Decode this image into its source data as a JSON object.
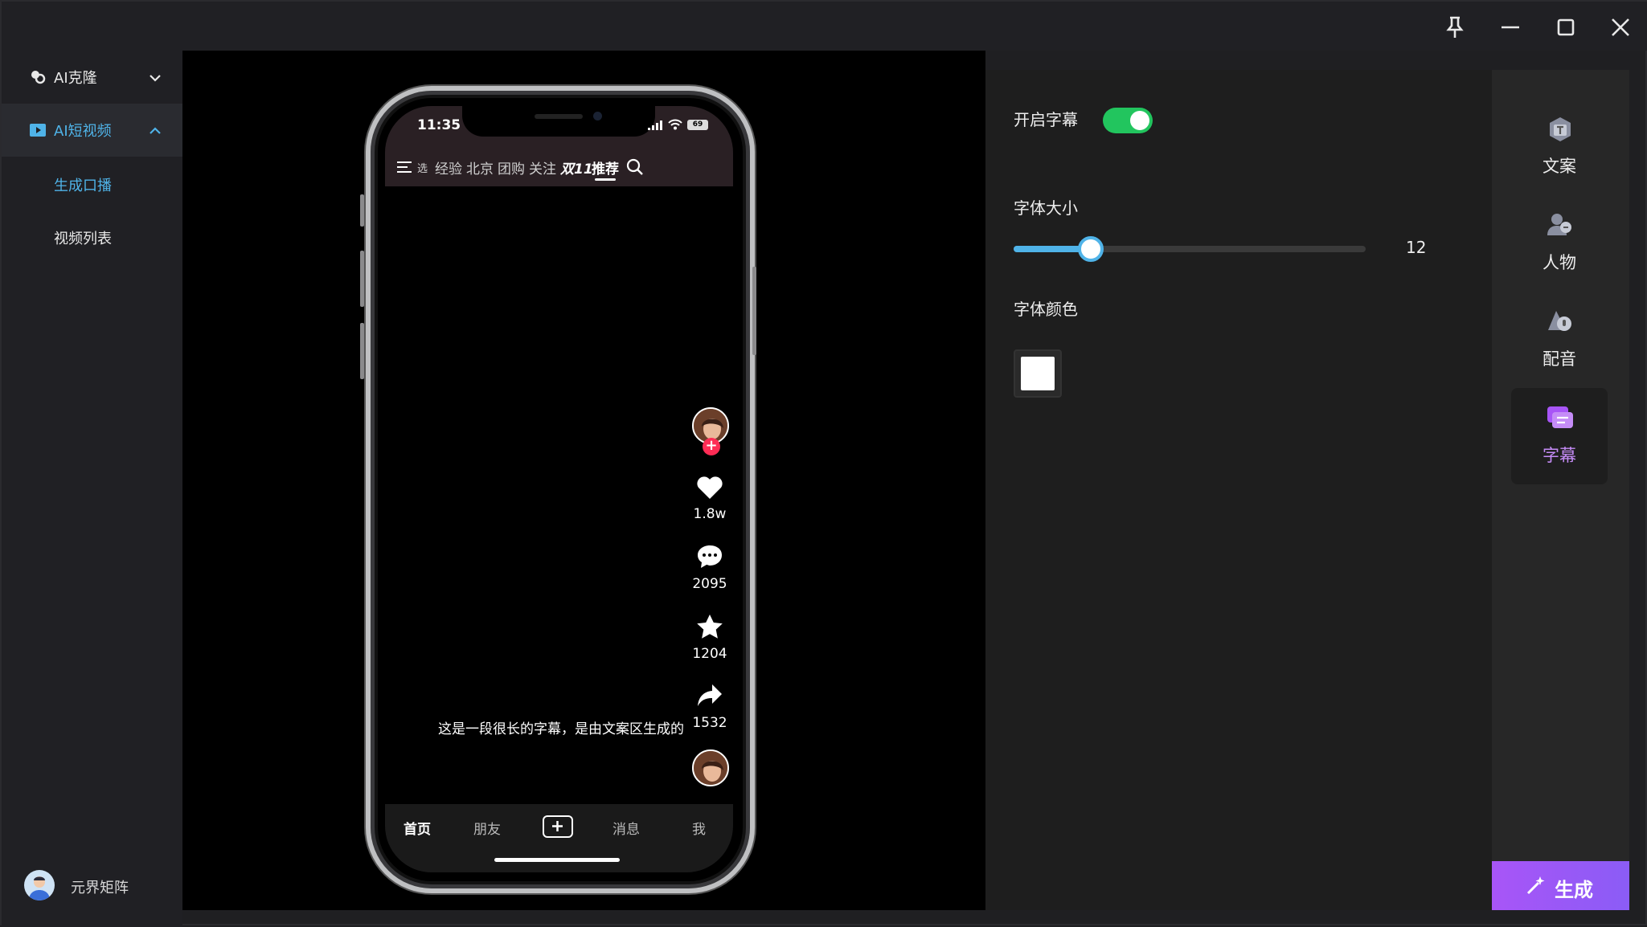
{
  "sidebar": {
    "groups": [
      {
        "label": "AI克隆",
        "icon": "ai-clone-icon",
        "expanded": false
      },
      {
        "label": "AI短视频",
        "icon": "video-icon",
        "expanded": true
      }
    ],
    "sub_items": [
      {
        "label": "生成口播",
        "active": true
      },
      {
        "label": "视频列表",
        "active": false
      }
    ],
    "user": {
      "name": "元界矩阵"
    }
  },
  "phone": {
    "time": "11:35",
    "battery": "69",
    "tabs": [
      "选",
      "经验",
      "北京",
      "团购",
      "关注",
      "双11",
      "推荐"
    ],
    "active_tab": "推荐",
    "stats": {
      "likes": "1.8w",
      "comments": "2095",
      "favorites": "1204",
      "shares": "1532"
    },
    "caption": "这是一段很长的字幕，是由文案区生成的",
    "bottom_nav": [
      "首页",
      "朋友",
      "消息",
      "我"
    ]
  },
  "settings": {
    "subtitle_toggle_label": "开启字幕",
    "subtitle_enabled": true,
    "font_size_label": "字体大小",
    "font_size_value": "12",
    "font_size_fraction": 0.22,
    "font_color_label": "字体颜色",
    "font_color": "#ffffff"
  },
  "tools": [
    {
      "label": "文案",
      "icon": "copywriting-icon"
    },
    {
      "label": "人物",
      "icon": "person-icon"
    },
    {
      "label": "配音",
      "icon": "voiceover-icon"
    },
    {
      "label": "字幕",
      "icon": "subtitle-icon",
      "active": true
    }
  ],
  "generate_button": {
    "label": "生成",
    "icon": "magic-wand-icon"
  },
  "colors": {
    "accent_blue": "#4fb3e8",
    "toggle_green": "#22c55e",
    "accent_purple": "#a855f7",
    "badge_red": "#fe2c55"
  }
}
